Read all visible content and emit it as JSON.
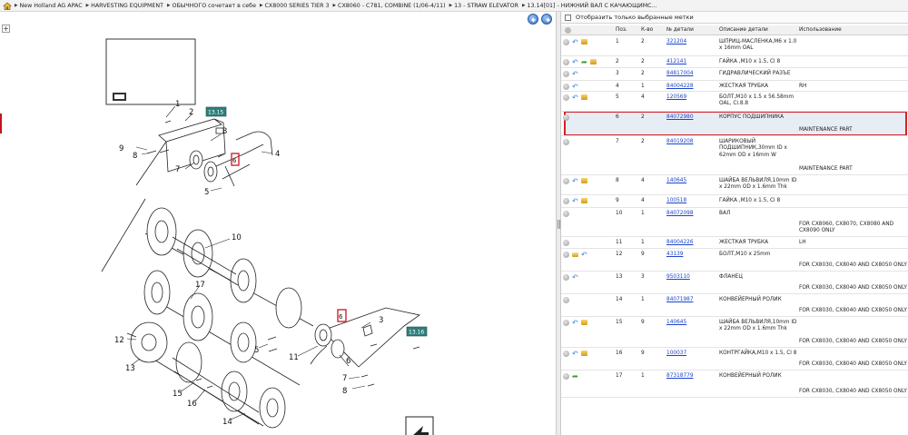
{
  "breadcrumb": [
    "New Holland AG APAC",
    "HARVESTING EQUIPMENT",
    "ОБЫЧНОГО сочетает в себе",
    "CX8000 SERIES TIER 3",
    "CX8060 - C781, COMBINE (1/06-4/11)",
    "13 - STRAW ELEVATOR",
    "13.14[01] - НИЖНИЙ ВАЛ С КАЧАЮЩИМС..."
  ],
  "filter_label": "Отобразить только выбранные метки",
  "columns": [
    "Поз.",
    "К-во",
    "№ детали",
    "Описание детали",
    "Использование"
  ],
  "diagram": {
    "callouts": [
      "1",
      "2",
      "3",
      "4",
      "5",
      "7",
      "8",
      "9",
      "10",
      "17",
      "3",
      "12",
      "13",
      "5",
      "11",
      "6",
      "7",
      "8",
      "15",
      "16",
      "14",
      "6"
    ],
    "tags": [
      "13.15",
      "13.16"
    ]
  },
  "rows": [
    {
      "pos": "1",
      "qty": "2",
      "pn": "321204",
      "desc": "ШПРИЦ-МАСЛЕНКА,M6 x 1.0 x 16mm OAL",
      "usage": "",
      "note": ""
    },
    {
      "pos": "2",
      "qty": "2",
      "pn": "412141",
      "desc": "ГАЙКА ,M10 x 1.5, Cl 8",
      "usage": "",
      "note": ""
    },
    {
      "pos": "3",
      "qty": "2",
      "pn": "84817004",
      "desc": "ГИДРАВЛИЧЕСКИЙ РАЗЪЕ",
      "usage": "",
      "note": ""
    },
    {
      "pos": "4",
      "qty": "1",
      "pn": "84004228",
      "desc": "ЖЕСТКАЯ ТРУБКА",
      "usage": "RH",
      "note": ""
    },
    {
      "pos": "5",
      "qty": "4",
      "pn": "120569",
      "desc": "БОЛТ,M10 x 1.5 x 56.58mm OAL, Cl.8.8",
      "usage": "",
      "note": ""
    },
    {
      "pos": "6",
      "qty": "2",
      "pn": "84072980",
      "desc": "КОРПУС ПОДШИПНИКА",
      "usage": "",
      "note": "MAINTENANCE PART"
    },
    {
      "pos": "7",
      "qty": "2",
      "pn": "84019208",
      "desc": "ШАРИКОВЫЙ ПОДШИПНИК,30mm ID x 62mm OD x 16mm W",
      "usage": "",
      "note": "MAINTENANCE PART"
    },
    {
      "pos": "8",
      "qty": "4",
      "pn": "140645",
      "desc": "ШАЙБА ВЕЛЬВИЛЯ,10mm ID x 22mm OD x 1.6mm Thk",
      "usage": "",
      "note": ""
    },
    {
      "pos": "9",
      "qty": "4",
      "pn": "100518",
      "desc": "ГАЙКА ,M10 x 1.5, Cl 8",
      "usage": "",
      "note": ""
    },
    {
      "pos": "10",
      "qty": "1",
      "pn": "84072098",
      "desc": "ВАЛ",
      "usage": "",
      "note": "FOR CX8060, CX8070, CX8080 AND CX8090 ONLY"
    },
    {
      "pos": "11",
      "qty": "1",
      "pn": "84004226",
      "desc": "ЖЕСТКАЯ ТРУБКА",
      "usage": "LH",
      "note": ""
    },
    {
      "pos": "12",
      "qty": "9",
      "pn": "43139",
      "desc": "БОЛТ,M10 x 25mm",
      "usage": "",
      "note": "FOR CX8030, CX8040 AND CX8050 ONLY"
    },
    {
      "pos": "13",
      "qty": "3",
      "pn": "9503110",
      "desc": "ФЛАНЕЦ",
      "usage": "",
      "note": "FOR CX8030, CX8040 AND CX8050 ONLY"
    },
    {
      "pos": "14",
      "qty": "1",
      "pn": "84071987",
      "desc": "КОНВЕЙЕРНЫЙ РОЛИК",
      "usage": "",
      "note": "FOR CX8030, CX8040 AND CX8050 ONLY"
    },
    {
      "pos": "15",
      "qty": "9",
      "pn": "140645",
      "desc": "ШАЙБА ВЕЛЬВИЛЯ,10mm ID x 22mm OD x 1.6mm Thk",
      "usage": "",
      "note": "FOR CX8030, CX8040 AND CX8050 ONLY"
    },
    {
      "pos": "16",
      "qty": "9",
      "pn": "100037",
      "desc": "КОНТРГАЙКА,M10 x 1.5, Cl 8",
      "usage": "",
      "note": "FOR CX8030, CX8040 AND CX8050 ONLY"
    },
    {
      "pos": "17",
      "qty": "1",
      "pn": "87318779",
      "desc": "КОНВЕЙЕРНЫЙ РОЛИК",
      "usage": "",
      "note": "FOR CX8030, CX8040 AND CX8050 ONLY"
    }
  ]
}
